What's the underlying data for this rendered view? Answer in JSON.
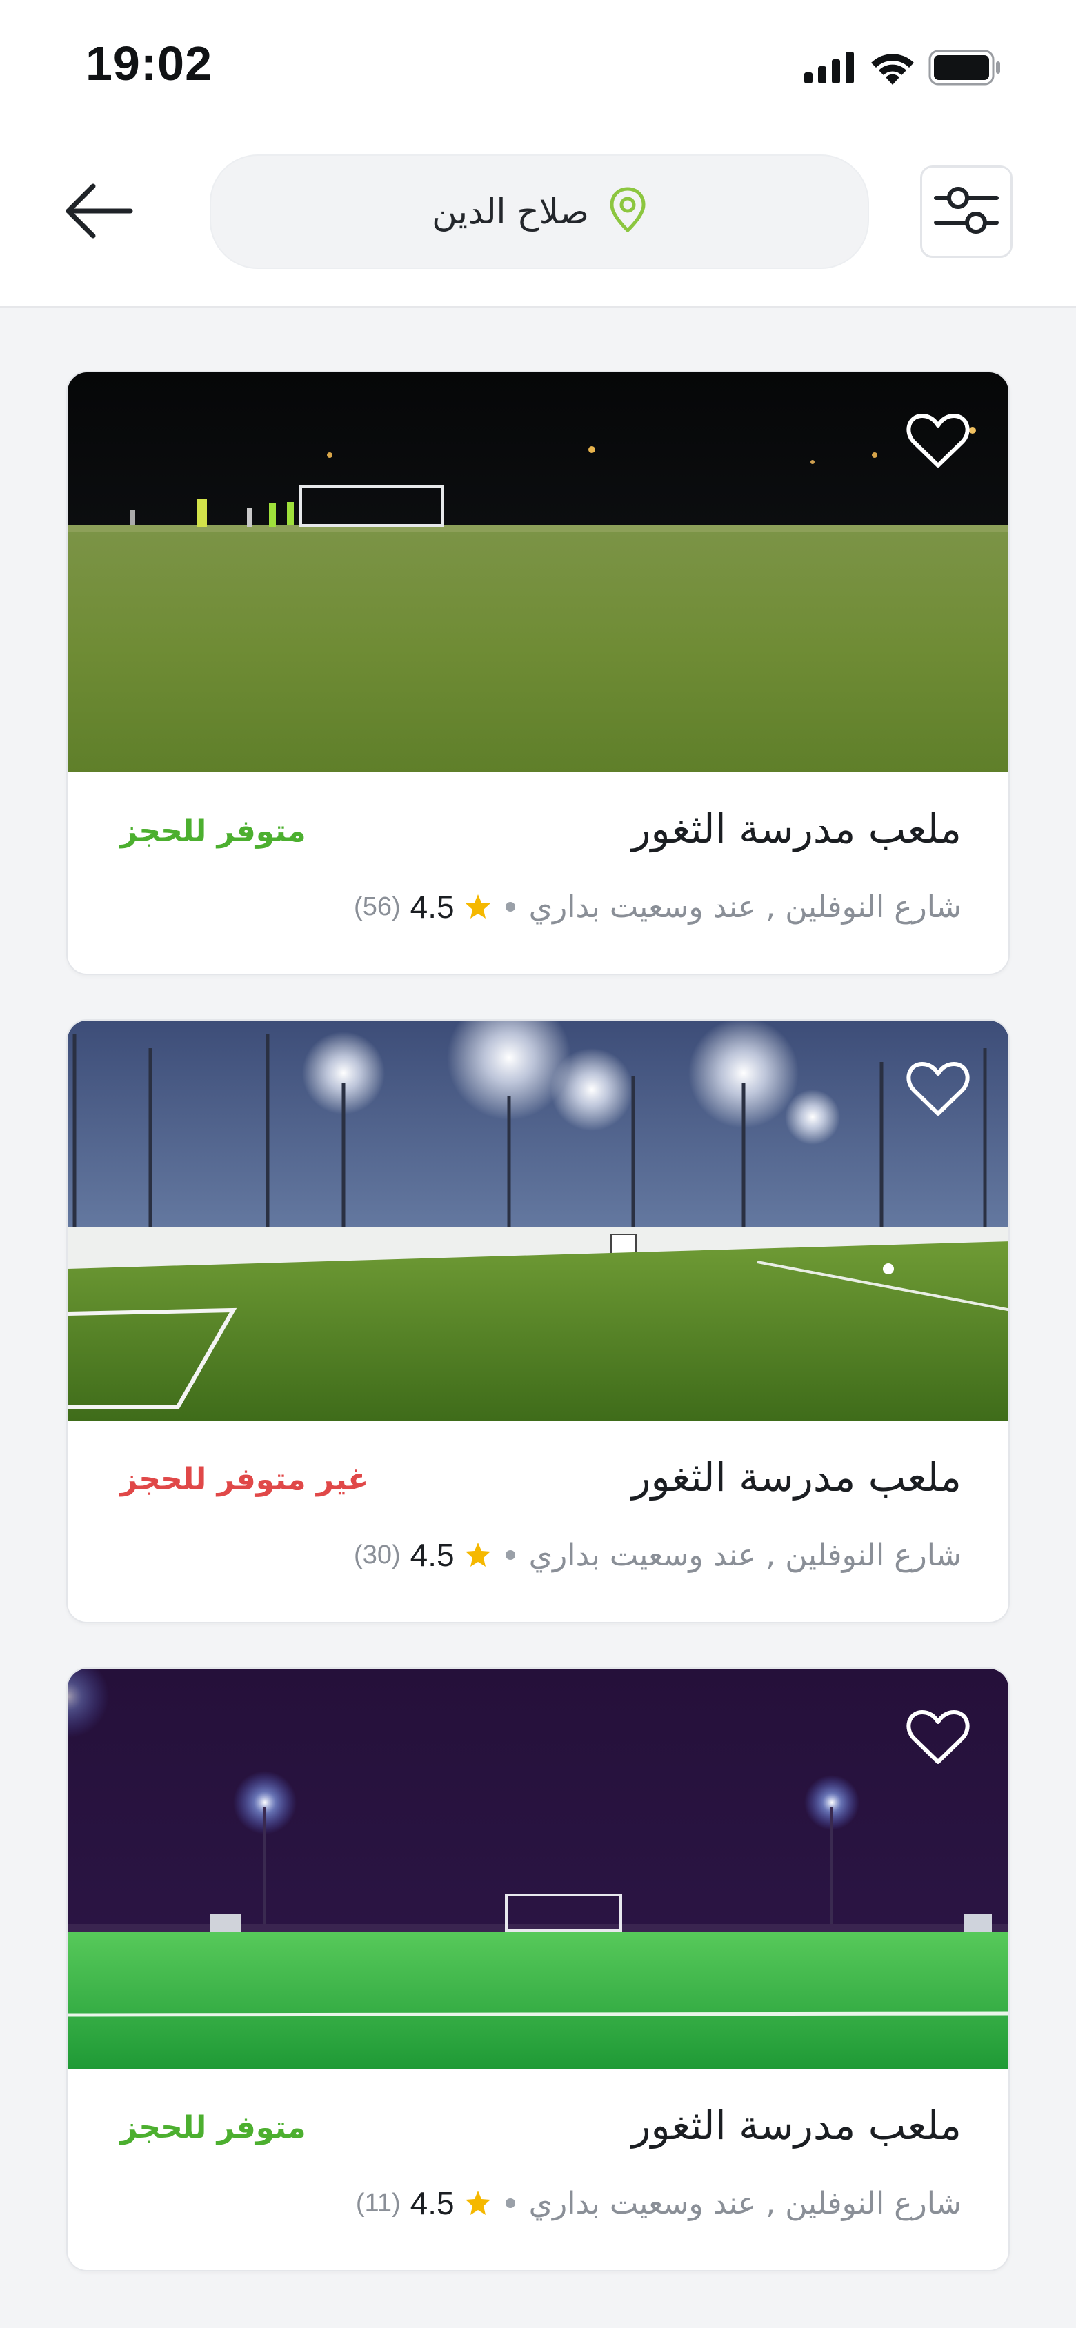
{
  "status_bar": {
    "time": "19:02",
    "icons": [
      "cellular-signal-icon",
      "wifi-icon",
      "battery-icon"
    ]
  },
  "header": {
    "back_icon": "arrow-left-icon",
    "location": {
      "text": "صلاح الدين",
      "icon": "map-pin-icon",
      "icon_color": "#8cc63f"
    },
    "filter_icon": "sliders-icon"
  },
  "colors": {
    "available": "#4caf2f",
    "unavailable": "#e04848",
    "star": "#f5b800"
  },
  "venues": [
    {
      "title": "ملعب مدرسة الثغور",
      "address": "شارع النوفلين , عند وسعيت بداري",
      "rating": "4.5",
      "reviews": "(56)",
      "status": "متوفر للحجز",
      "available": true,
      "photo": "night grass field with players and goal"
    },
    {
      "title": "ملعب مدرسة الثغور",
      "address": "شارع النوفلين , عند وسعيت بداري",
      "rating": "4.5",
      "reviews": "(30)",
      "status": "غير متوفر للحجز",
      "available": false,
      "photo": "caged artificial turf pitch under floodlights"
    },
    {
      "title": "ملعب مدرسة الثغور",
      "address": "شارع النوفلين , عند وسعيت بداري",
      "rating": "4.5",
      "reviews": "(11)",
      "status": "متوفر للحجز",
      "available": true,
      "photo": "turf field at night with purple sky and floodlights"
    }
  ]
}
